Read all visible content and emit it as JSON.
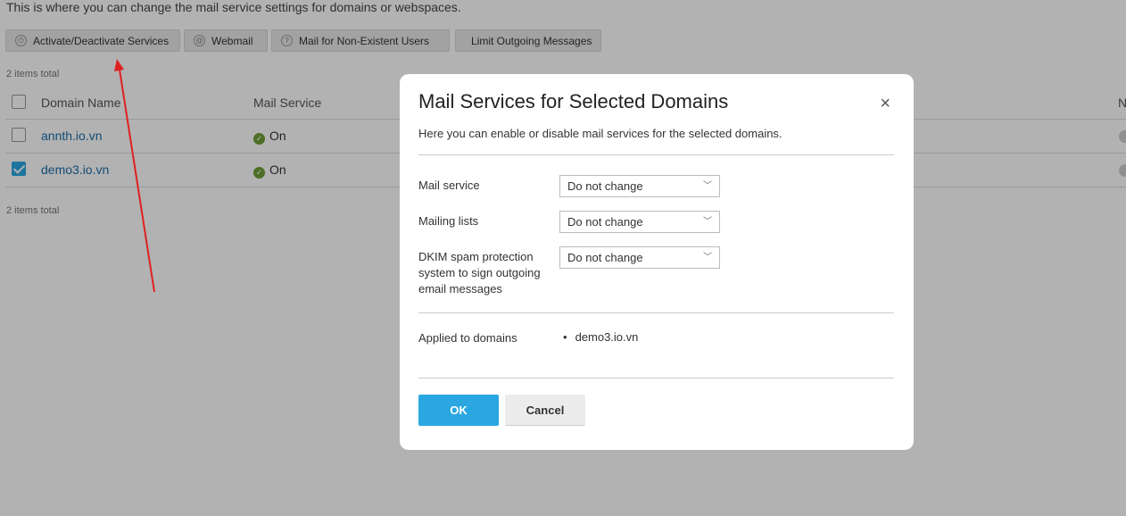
{
  "page": {
    "intro": "This is where you can change the mail service settings for domains or webspaces.",
    "toolbar": {
      "activate": "Activate/Deactivate Services",
      "webmail": "Webmail",
      "nonexistent": "Mail for Non-Existent Users",
      "limit": "Limit Outgoing Messages"
    },
    "items_total": "2 items total",
    "columns": {
      "domain": "Domain Name",
      "mail_service": "Mail Service",
      "partial": "N"
    },
    "rows": [
      {
        "domain": "annth.io.vn",
        "mail_service": "On",
        "checked": false
      },
      {
        "domain": "demo3.io.vn",
        "mail_service": "On",
        "checked": true
      }
    ]
  },
  "modal": {
    "title": "Mail Services for Selected Domains",
    "description": "Here you can enable or disable mail services for the selected domains.",
    "fields": [
      {
        "label": "Mail service",
        "value": "Do not change"
      },
      {
        "label": "Mailing lists",
        "value": "Do not change"
      },
      {
        "label": "DKIM spam protection system to sign outgoing email messages",
        "value": "Do not change"
      }
    ],
    "applied_label": "Applied to domains",
    "applied_domains": [
      "demo3.io.vn"
    ],
    "ok_label": "OK",
    "cancel_label": "Cancel",
    "close_icon": "close-icon"
  },
  "colors": {
    "accent": "#2aa7e0",
    "link": "#1a6ea8",
    "status_on": "#6e9e35",
    "annotation_arrow": "#e02020"
  }
}
